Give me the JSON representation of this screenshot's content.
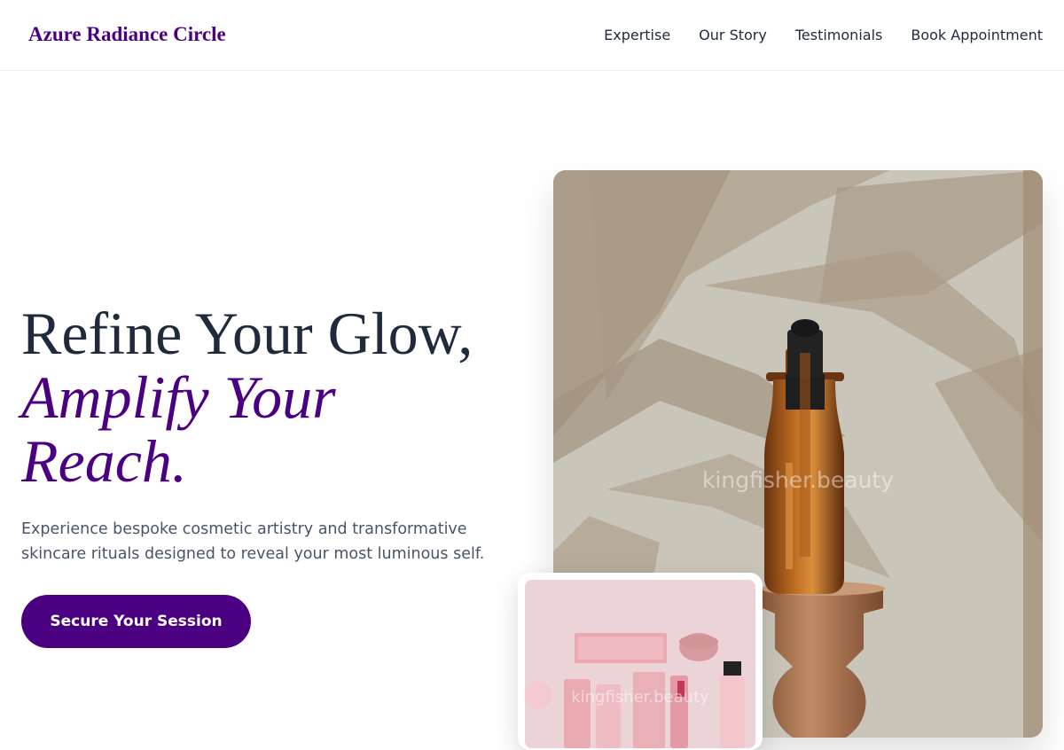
{
  "brand": {
    "name": "Azure Radiance Circle"
  },
  "nav": {
    "items": [
      {
        "label": "Expertise"
      },
      {
        "label": "Our Story"
      },
      {
        "label": "Testimonials"
      },
      {
        "label": "Book Appointment"
      }
    ]
  },
  "hero": {
    "title_line1": "Refine Your Glow,",
    "title_line2": "Amplify Your",
    "title_line3": "Reach.",
    "subtitle": "Experience bespoke cosmetic artistry and transformative skincare rituals designed to reveal your most luminous self.",
    "cta_label": "Secure Your Session"
  },
  "images": {
    "main_watermark": "kingfisher.beauty",
    "thumb_watermark": "kingfisher.beauty"
  },
  "colors": {
    "brand": "#4b0082",
    "text_dark": "#1f2a3d",
    "text_muted": "#4a5468"
  }
}
